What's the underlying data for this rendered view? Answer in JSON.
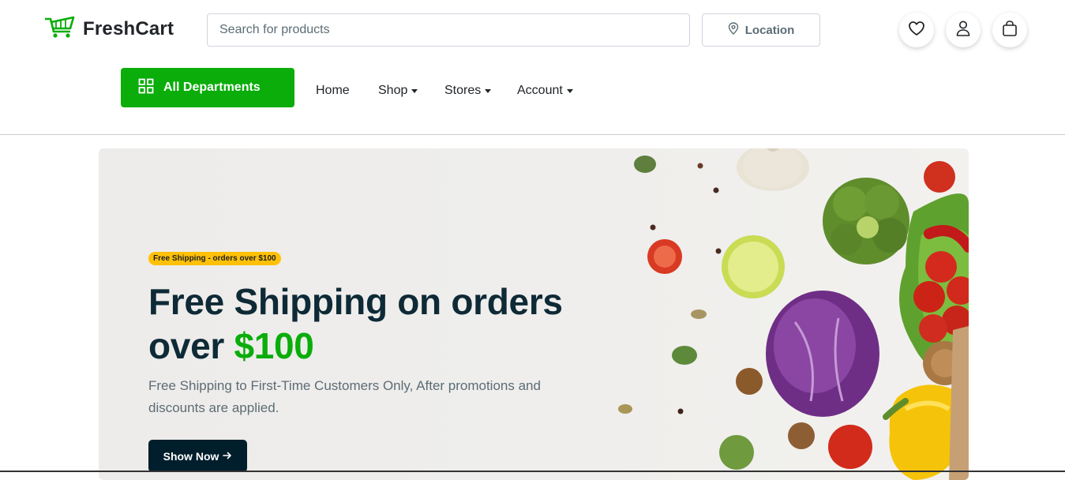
{
  "brand": {
    "name": "FreshCart",
    "logo_icon": "cart-icon",
    "color": "#0aad0a"
  },
  "header": {
    "search_placeholder": "Search for products",
    "location_label": "Location",
    "icons": [
      "heart-icon",
      "user-icon",
      "bag-icon"
    ]
  },
  "nav": {
    "departments_label": "All Departments",
    "items": [
      {
        "label": "Home",
        "dropdown": false
      },
      {
        "label": "Shop",
        "dropdown": true
      },
      {
        "label": "Stores",
        "dropdown": true
      },
      {
        "label": "Account",
        "dropdown": true
      }
    ]
  },
  "hero": {
    "badge": "Free Shipping - orders over $100",
    "headline_part1": "Free Shipping on orders over ",
    "headline_accent": "$100",
    "subtext": "Free Shipping to First-Time Customers Only, After promotions and discounts are applied.",
    "cta_label": "Show Now",
    "cta_icon": "arrow-right-icon"
  },
  "colors": {
    "accent": "#0aad0a",
    "badge": "#ffc107",
    "dark": "#001e2b",
    "headline": "#0e2a36"
  }
}
